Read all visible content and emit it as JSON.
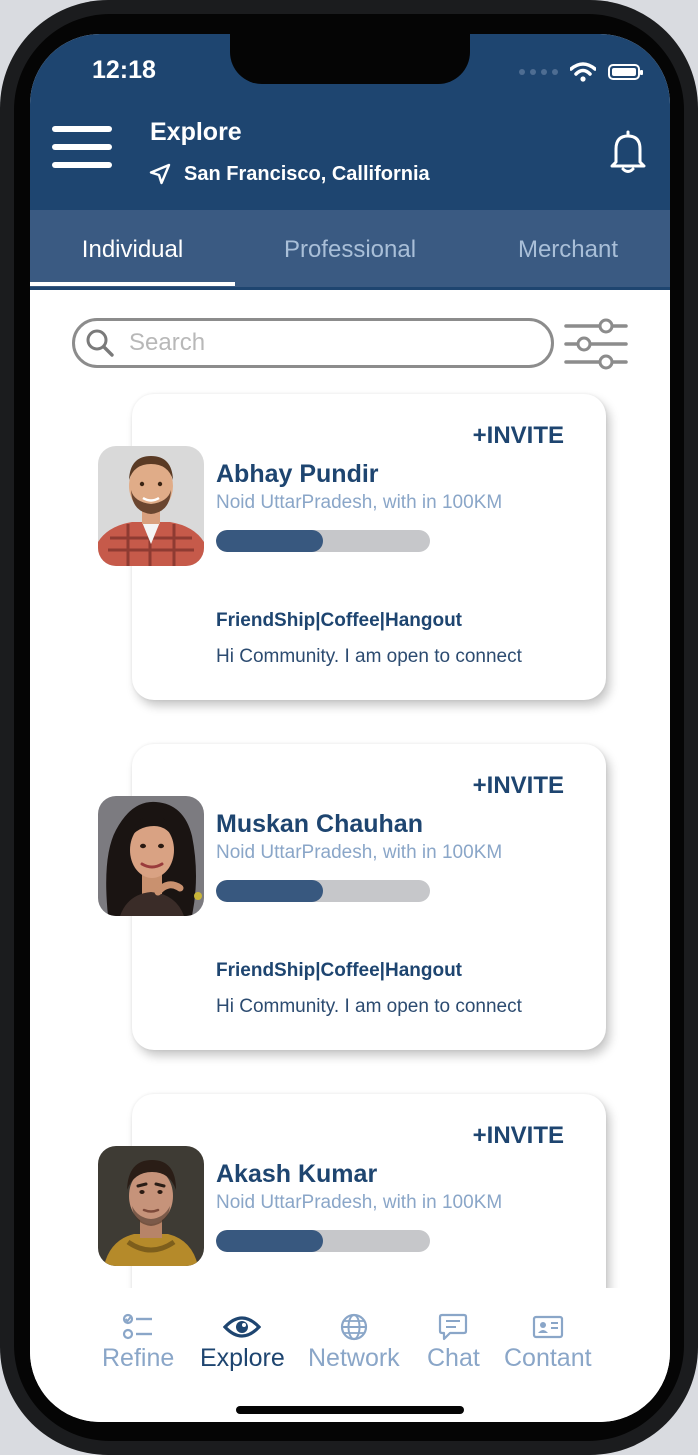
{
  "status_bar": {
    "time": "12:18"
  },
  "header": {
    "title": "Explore",
    "location": "San Francisco, Callifornia",
    "menu_icon": "hamburger-menu-icon",
    "notification_icon": "bell-icon"
  },
  "tabs": [
    {
      "label": "Individual",
      "active": true
    },
    {
      "label": "Professional",
      "active": false
    },
    {
      "label": "Merchant",
      "active": false
    }
  ],
  "search": {
    "placeholder": "Search",
    "value": ""
  },
  "cards": [
    {
      "invite_label": "+INVITE",
      "name": "Abhay Pundir",
      "distance": "Noid UttarPradesh, with in 100KM",
      "progress": 0.5,
      "interests": "FriendShip|Coffee|Hangout",
      "bio": "Hi Community. I am open to connect"
    },
    {
      "invite_label": "+INVITE",
      "name": "Muskan Chauhan",
      "distance": "Noid UttarPradesh, with in 100KM",
      "progress": 0.5,
      "interests": "FriendShip|Coffee|Hangout",
      "bio": "Hi Community. I am open to connect"
    },
    {
      "invite_label": "+INVITE",
      "name": "Akash Kumar",
      "distance": "Noid UttarPradesh, with in 100KM",
      "progress": 0.5
    }
  ],
  "bottom_nav": [
    {
      "label": "Refine",
      "icon": "checklist-icon",
      "active": false
    },
    {
      "label": "Explore",
      "icon": "eye-icon",
      "active": true
    },
    {
      "label": "Network",
      "icon": "globe-icon",
      "active": false
    },
    {
      "label": "Chat",
      "icon": "chat-bubble-icon",
      "active": false
    },
    {
      "label": "Contant",
      "icon": "contact-card-icon",
      "active": false
    }
  ],
  "colors": {
    "primary": "#1e4570",
    "tab_bar": "#3a5a82",
    "inactive_text": "#8aa6c8",
    "progress_fill": "#38587f",
    "progress_track": "#c6c7ca"
  }
}
